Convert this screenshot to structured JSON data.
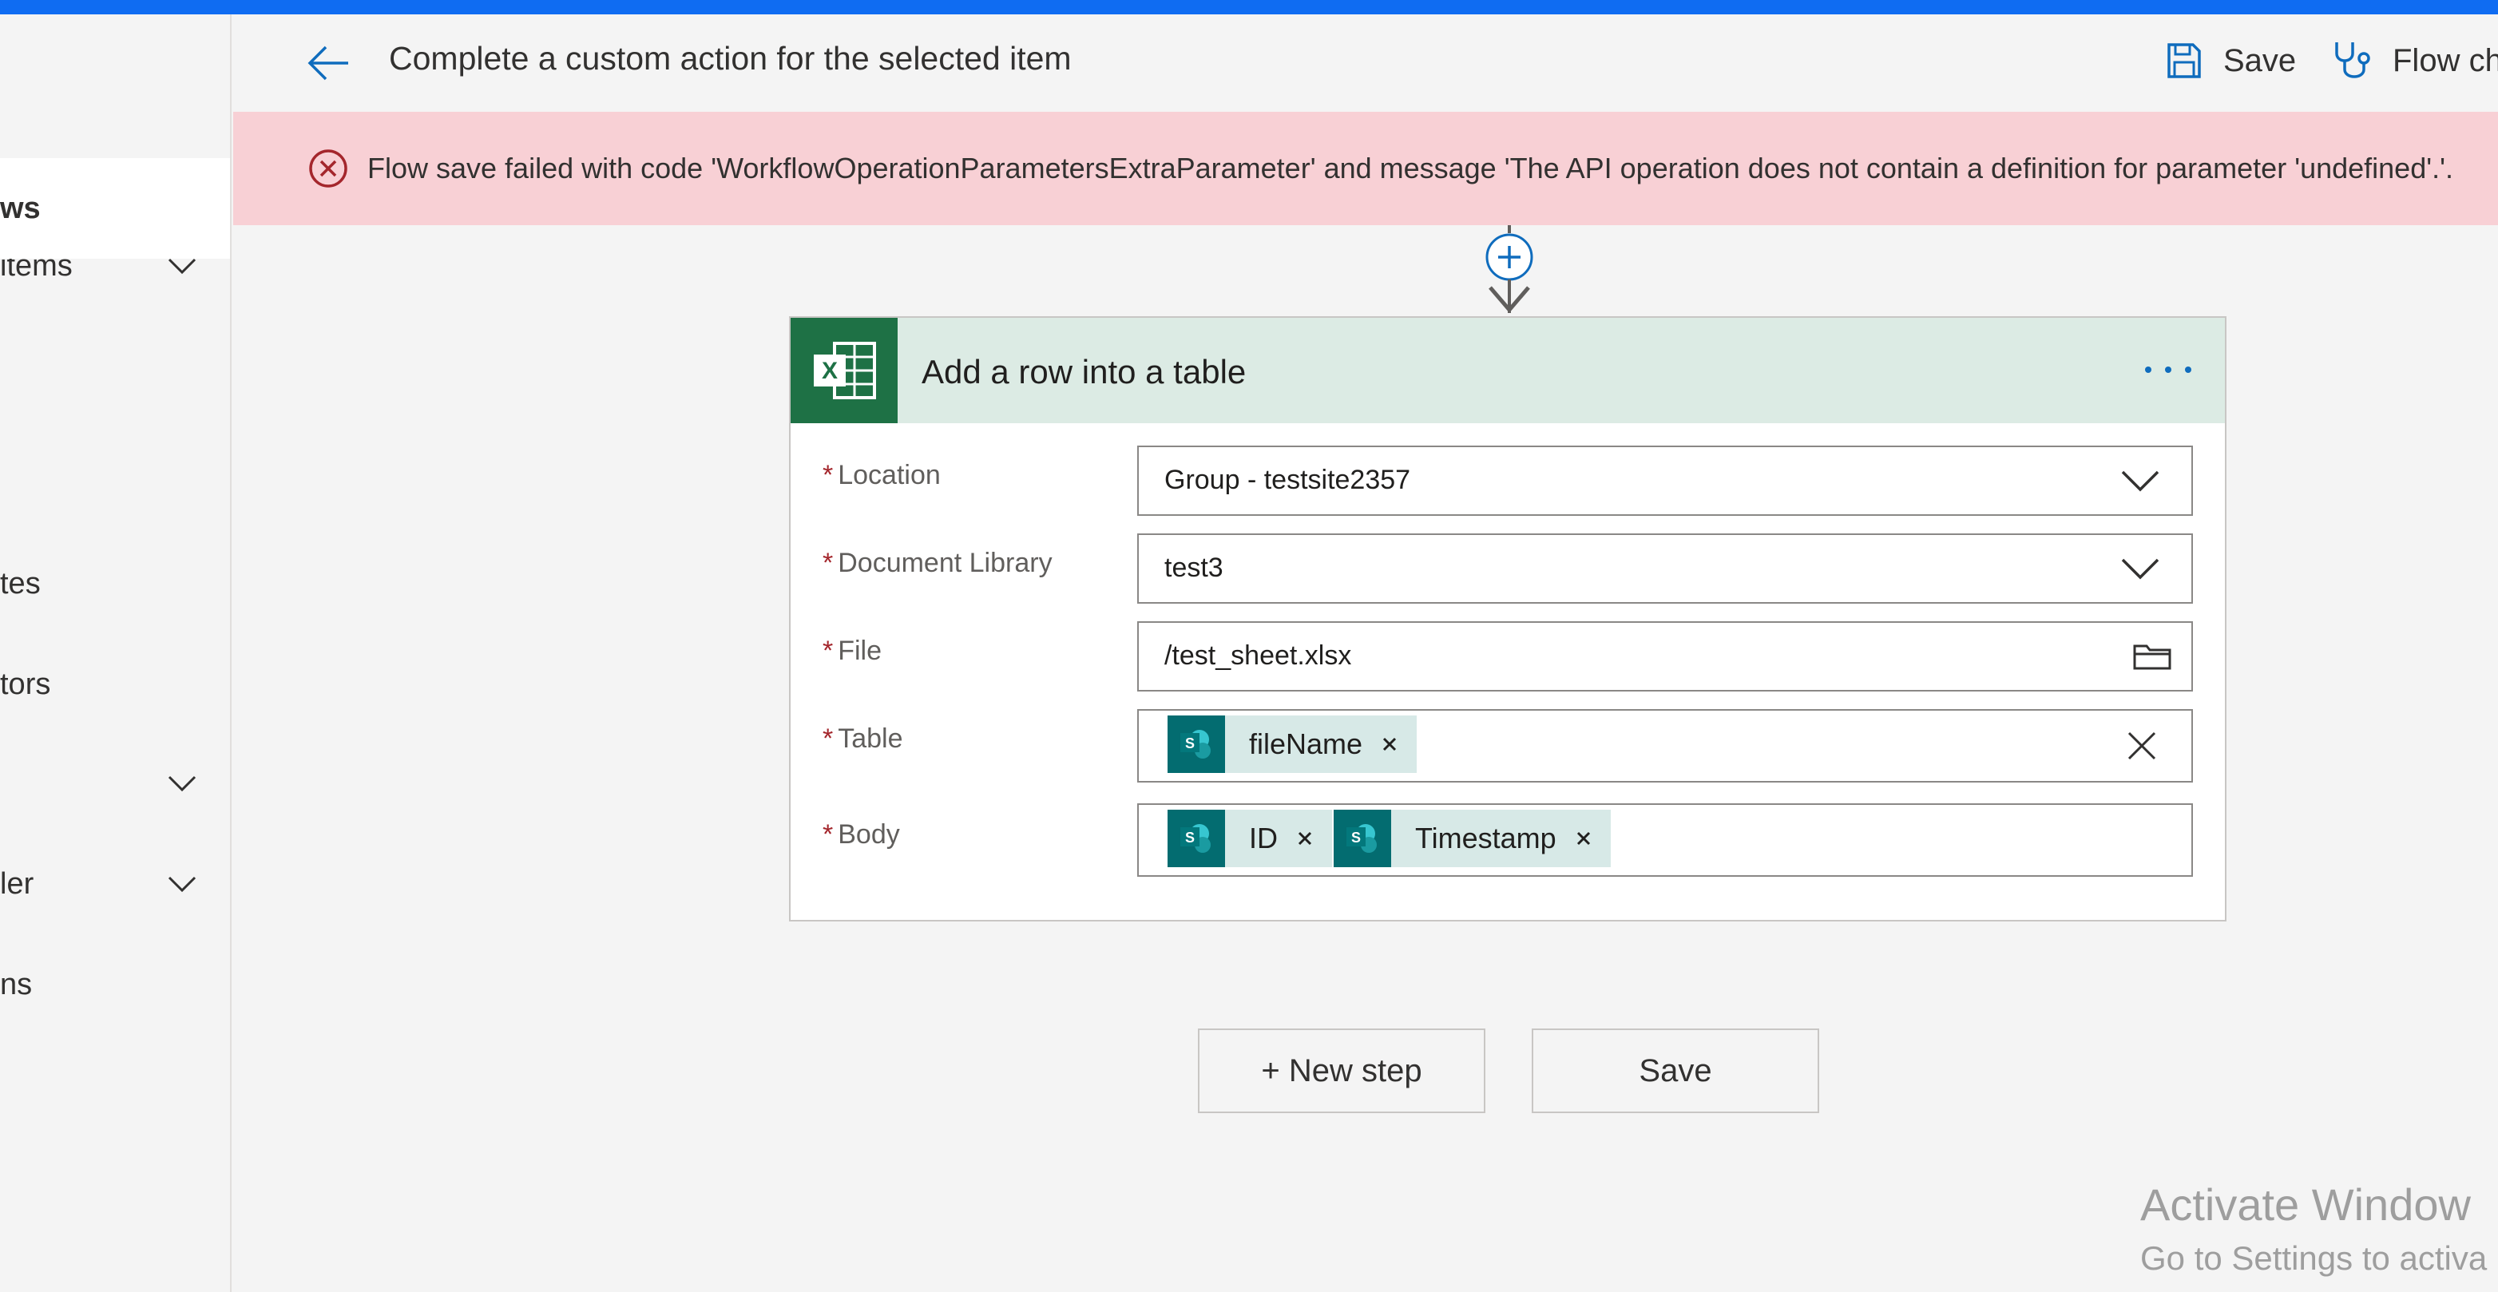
{
  "sidebar": {
    "items": [
      {
        "label": "items",
        "active": false,
        "chevron": true
      },
      {
        "label": "ws",
        "active": true,
        "chevron": false
      },
      {
        "label": "tes",
        "active": false,
        "chevron": false
      },
      {
        "label": "tors",
        "active": false,
        "chevron": false
      },
      {
        "label": "",
        "active": false,
        "chevron": true
      },
      {
        "label": "ler",
        "active": false,
        "chevron": true
      },
      {
        "label": "ns",
        "active": false,
        "chevron": false
      }
    ]
  },
  "header": {
    "title": "Complete a custom action for the selected item",
    "save_label": "Save",
    "flow_checker_label": "Flow ch"
  },
  "error": {
    "message": "Flow save failed with code 'WorkflowOperationParametersExtraParameter' and message 'The API operation does not contain a definition for parameter 'undefined'.'."
  },
  "action_card": {
    "title": "Add a row into a table",
    "fields": {
      "location": {
        "label": "Location",
        "value": "Group - testsite2357"
      },
      "library": {
        "label": "Document Library",
        "value": "test3"
      },
      "file": {
        "label": "File",
        "value": "/test_sheet.xlsx"
      },
      "table": {
        "label": "Table",
        "tokens": [
          "fileName"
        ]
      },
      "body": {
        "label": "Body",
        "tokens": [
          "ID",
          "Timestamp"
        ]
      }
    },
    "required_mark": "*"
  },
  "buttons": {
    "new_step": "+ New step",
    "save": "Save"
  },
  "watermark": {
    "line1": "Activate Window",
    "line2": "Go to Settings to activa"
  },
  "colors": {
    "top_accent": "#0f6cf2",
    "error_bg": "#f8d0d5",
    "error_icon": "#a4262c",
    "card_header_bg": "#dcebe4",
    "excel_green": "#1e7145",
    "sharepoint_teal": "#036c70",
    "link_blue": "#0f6cbd"
  },
  "icons": {
    "back": "arrow-left-icon",
    "save": "floppy-disk-icon",
    "flow_checker": "stethoscope-icon",
    "error": "error-circle-icon",
    "excel": "excel-icon",
    "more": "more-dots-icon",
    "dropdown": "chevron-down-icon",
    "folder": "folder-icon",
    "clear": "close-icon",
    "sharepoint": "sharepoint-icon"
  }
}
